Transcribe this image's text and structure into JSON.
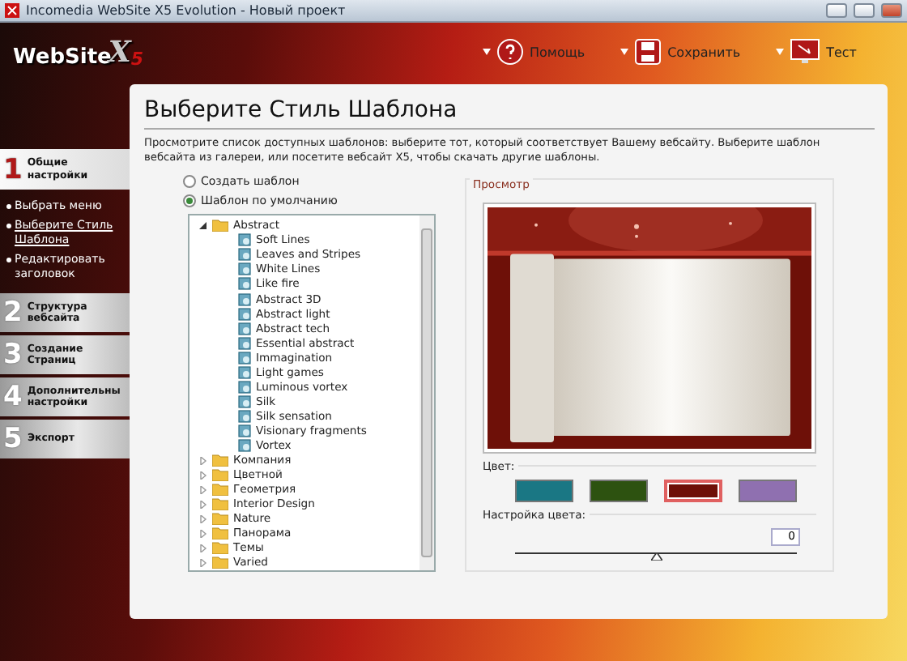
{
  "window": {
    "title": "Incomedia WebSite X5 Evolution - Новый проект"
  },
  "logo": {
    "name": "WebSite",
    "mark": "X",
    "sub": "5"
  },
  "toolbar": [
    {
      "label": "Помощь",
      "kind": "help"
    },
    {
      "label": "Сохранить",
      "kind": "save"
    },
    {
      "label": "Тест",
      "kind": "test"
    }
  ],
  "steps": [
    {
      "number": "1",
      "label": "Общие настройки",
      "selected": true,
      "children": [
        {
          "label": "Выбрать меню",
          "selected": false
        },
        {
          "label": "Выберите Стиль Шаблона",
          "selected": true
        },
        {
          "label": "Редактировать заголовок",
          "selected": false
        }
      ]
    },
    {
      "number": "2",
      "label": "Структура вебсайта",
      "selected": false
    },
    {
      "number": "3",
      "label": "Создание Страниц",
      "selected": false
    },
    {
      "number": "4",
      "label": "Дополнительны настройки",
      "selected": false
    },
    {
      "number": "5",
      "label": "Экспорт",
      "selected": false
    }
  ],
  "page": {
    "title": "Выберите Стиль Шаблона",
    "description": "Просмотрите список доступных шаблонов: выберите тот, который соответствует Вашему вебсайту. Выберите шаблон вебсайта из галереи, или посетите вебсайт X5, чтобы скачать другие шаблоны."
  },
  "options": [
    {
      "label": "Создать шаблон",
      "selected": false
    },
    {
      "label": "Шаблон по умолчанию",
      "selected": true
    }
  ],
  "tree": [
    {
      "label": "Abstract",
      "expanded": true,
      "children": [
        {
          "label": "Soft Lines"
        },
        {
          "label": "Leaves and Stripes"
        },
        {
          "label": "White Lines"
        },
        {
          "label": "Like fire"
        },
        {
          "label": "Abstract 3D"
        },
        {
          "label": "Abstract light"
        },
        {
          "label": "Abstract tech"
        },
        {
          "label": "Essential abstract"
        },
        {
          "label": "Immagination"
        },
        {
          "label": "Light games"
        },
        {
          "label": "Luminous vortex"
        },
        {
          "label": "Silk"
        },
        {
          "label": "Silk sensation"
        },
        {
          "label": "Visionary fragments"
        },
        {
          "label": "Vortex"
        }
      ]
    },
    {
      "label": "Компания",
      "expanded": false
    },
    {
      "label": "Цветной",
      "expanded": false
    },
    {
      "label": "Геометрия",
      "expanded": false
    },
    {
      "label": "Interior Design",
      "expanded": false
    },
    {
      "label": "Nature",
      "expanded": false
    },
    {
      "label": "Панорама",
      "expanded": false
    },
    {
      "label": "Темы",
      "expanded": false
    },
    {
      "label": "Varied",
      "expanded": false
    }
  ],
  "preview": {
    "legend": "Просмотр",
    "kind": "picture"
  },
  "colors": {
    "label": "Цвет:",
    "swatches": [
      {
        "color": "#1a7784",
        "selected": false
      },
      {
        "color": "#2d5210",
        "selected": false
      },
      {
        "color": "#6e1008",
        "selected": true
      },
      {
        "color": "#8f70b0",
        "selected": false
      }
    ]
  },
  "adjust": {
    "label": "Настройка цвета:",
    "value": "0",
    "level": 0.5
  }
}
